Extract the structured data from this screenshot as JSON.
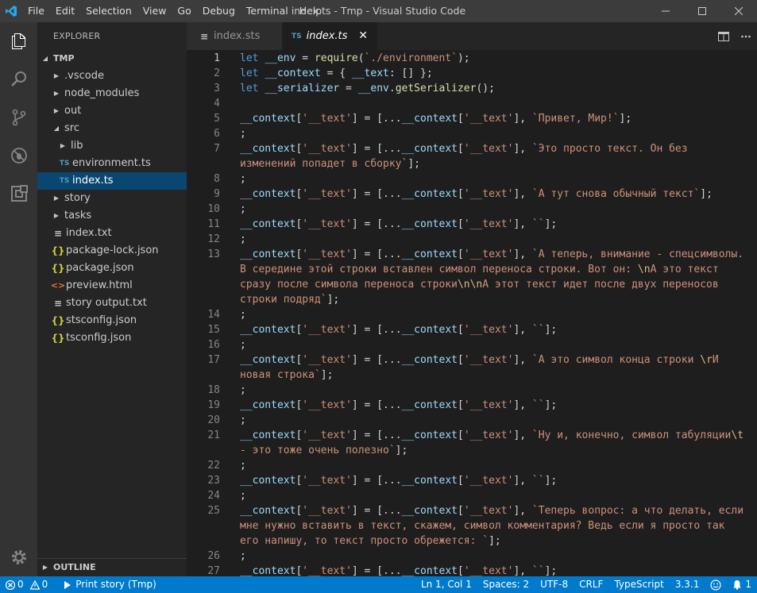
{
  "menu": [
    "File",
    "Edit",
    "Selection",
    "View",
    "Go",
    "Debug",
    "Terminal",
    "Help"
  ],
  "window_title": "index.ts - Tmp - Visual Studio Code",
  "sidebar": {
    "header": "EXPLORER",
    "root": "TMP",
    "items": [
      {
        "label": ".vscode",
        "kind": "folder",
        "level": 1,
        "open": false
      },
      {
        "label": "node_modules",
        "kind": "folder",
        "level": 1,
        "open": false
      },
      {
        "label": "out",
        "kind": "folder",
        "level": 1,
        "open": false
      },
      {
        "label": "src",
        "kind": "folder",
        "level": 1,
        "open": true
      },
      {
        "label": "lib",
        "kind": "folder",
        "level": 2,
        "open": false
      },
      {
        "label": "environment.ts",
        "kind": "ts",
        "level": 2
      },
      {
        "label": "index.ts",
        "kind": "ts",
        "level": 2,
        "selected": true
      },
      {
        "label": "story",
        "kind": "folder",
        "level": 1,
        "open": false
      },
      {
        "label": "tasks",
        "kind": "folder",
        "level": 1,
        "open": false
      },
      {
        "label": "index.txt",
        "kind": "txt",
        "level": 1
      },
      {
        "label": "package-lock.json",
        "kind": "json",
        "level": 1
      },
      {
        "label": "package.json",
        "kind": "json",
        "level": 1
      },
      {
        "label": "preview.html",
        "kind": "html",
        "level": 1
      },
      {
        "label": "story output.txt",
        "kind": "txt",
        "level": 1
      },
      {
        "label": "stsconfig.json",
        "kind": "json",
        "level": 1
      },
      {
        "label": "tsconfig.json",
        "kind": "json",
        "level": 1
      }
    ],
    "outline": "OUTLINE"
  },
  "tabs": [
    {
      "label": "index.sts",
      "active": false
    },
    {
      "label": "index.ts",
      "badge": "TS",
      "active": true,
      "close": "✕"
    }
  ],
  "code_lines": [
    {
      "n": "1",
      "parts": [
        [
          "k",
          "let"
        ],
        [
          "p",
          " "
        ],
        [
          "v",
          "__env"
        ],
        [
          "p",
          " = "
        ],
        [
          "f",
          "require"
        ],
        [
          "p",
          "("
        ],
        [
          "s",
          "`./environment`"
        ],
        [
          "p",
          ");"
        ]
      ]
    },
    {
      "n": "2",
      "parts": [
        [
          "k",
          "let"
        ],
        [
          "p",
          " "
        ],
        [
          "v",
          "__context"
        ],
        [
          "p",
          " = { "
        ],
        [
          "v",
          "__text"
        ],
        [
          "p",
          ": [] };"
        ]
      ]
    },
    {
      "n": "3",
      "parts": [
        [
          "k",
          "let"
        ],
        [
          "p",
          " "
        ],
        [
          "v",
          "__serializer"
        ],
        [
          "p",
          " = "
        ],
        [
          "v",
          "__env"
        ],
        [
          "p",
          "."
        ],
        [
          "f",
          "getSerializer"
        ],
        [
          "p",
          "();"
        ]
      ]
    },
    {
      "n": "4",
      "parts": []
    },
    {
      "n": "5",
      "parts": [
        [
          "v",
          "__context"
        ],
        [
          "p",
          "["
        ],
        [
          "s",
          "'__text'"
        ],
        [
          "p",
          "] = [..."
        ],
        [
          "v",
          "__context"
        ],
        [
          "p",
          "["
        ],
        [
          "s",
          "'__text'"
        ],
        [
          "p",
          "], "
        ],
        [
          "s",
          "`Привет, Мир!`"
        ],
        [
          "p",
          "];"
        ]
      ]
    },
    {
      "n": "6",
      "parts": [
        [
          "p",
          ";"
        ]
      ]
    },
    {
      "n": "7",
      "parts": [
        [
          "v",
          "__context"
        ],
        [
          "p",
          "["
        ],
        [
          "s",
          "'__text'"
        ],
        [
          "p",
          "] = [..."
        ],
        [
          "v",
          "__context"
        ],
        [
          "p",
          "["
        ],
        [
          "s",
          "'__text'"
        ],
        [
          "p",
          "], "
        ],
        [
          "s",
          "`Это просто текст. Он без"
        ]
      ]
    },
    {
      "n": "",
      "parts": [
        [
          "s",
          "изменений попадет в сборку`"
        ],
        [
          "p",
          "];"
        ]
      ]
    },
    {
      "n": "8",
      "parts": [
        [
          "p",
          ";"
        ]
      ]
    },
    {
      "n": "9",
      "parts": [
        [
          "v",
          "__context"
        ],
        [
          "p",
          "["
        ],
        [
          "s",
          "'__text'"
        ],
        [
          "p",
          "] = [..."
        ],
        [
          "v",
          "__context"
        ],
        [
          "p",
          "["
        ],
        [
          "s",
          "'__text'"
        ],
        [
          "p",
          "], "
        ],
        [
          "s",
          "`А тут снова обычный текст`"
        ],
        [
          "p",
          "];"
        ]
      ]
    },
    {
      "n": "10",
      "parts": [
        [
          "p",
          ";"
        ]
      ]
    },
    {
      "n": "11",
      "parts": [
        [
          "v",
          "__context"
        ],
        [
          "p",
          "["
        ],
        [
          "s",
          "'__text'"
        ],
        [
          "p",
          "] = [..."
        ],
        [
          "v",
          "__context"
        ],
        [
          "p",
          "["
        ],
        [
          "s",
          "'__text'"
        ],
        [
          "p",
          "], "
        ],
        [
          "s",
          "``"
        ],
        [
          "p",
          "];"
        ]
      ]
    },
    {
      "n": "12",
      "parts": [
        [
          "p",
          ";"
        ]
      ]
    },
    {
      "n": "13",
      "parts": [
        [
          "v",
          "__context"
        ],
        [
          "p",
          "["
        ],
        [
          "s",
          "'__text'"
        ],
        [
          "p",
          "] = [..."
        ],
        [
          "v",
          "__context"
        ],
        [
          "p",
          "["
        ],
        [
          "s",
          "'__text'"
        ],
        [
          "p",
          "], "
        ],
        [
          "s",
          "`А теперь, внимание - спецсимволы."
        ]
      ]
    },
    {
      "n": "",
      "parts": [
        [
          "s",
          "В середине этой строки вставлен символ переноса строки. Вот он: "
        ],
        [
          "e",
          "\\n"
        ],
        [
          "s",
          "А это текст"
        ]
      ]
    },
    {
      "n": "",
      "parts": [
        [
          "s",
          "сразу после символа переноса строки"
        ],
        [
          "e",
          "\\n\\n"
        ],
        [
          "s",
          "А этот текст идет после двух переносов"
        ]
      ]
    },
    {
      "n": "",
      "parts": [
        [
          "s",
          "строки подряд`"
        ],
        [
          "p",
          "];"
        ]
      ]
    },
    {
      "n": "14",
      "parts": [
        [
          "p",
          ";"
        ]
      ]
    },
    {
      "n": "15",
      "parts": [
        [
          "v",
          "__context"
        ],
        [
          "p",
          "["
        ],
        [
          "s",
          "'__text'"
        ],
        [
          "p",
          "] = [..."
        ],
        [
          "v",
          "__context"
        ],
        [
          "p",
          "["
        ],
        [
          "s",
          "'__text'"
        ],
        [
          "p",
          "], "
        ],
        [
          "s",
          "``"
        ],
        [
          "p",
          "];"
        ]
      ]
    },
    {
      "n": "16",
      "parts": [
        [
          "p",
          ";"
        ]
      ]
    },
    {
      "n": "17",
      "parts": [
        [
          "v",
          "__context"
        ],
        [
          "p",
          "["
        ],
        [
          "s",
          "'__text'"
        ],
        [
          "p",
          "] = [..."
        ],
        [
          "v",
          "__context"
        ],
        [
          "p",
          "["
        ],
        [
          "s",
          "'__text'"
        ],
        [
          "p",
          "], "
        ],
        [
          "s",
          "`А это символ конца строки "
        ],
        [
          "e",
          "\\r"
        ],
        [
          "s",
          "И"
        ]
      ]
    },
    {
      "n": "",
      "parts": [
        [
          "s",
          "новая строка`"
        ],
        [
          "p",
          "];"
        ]
      ]
    },
    {
      "n": "18",
      "parts": [
        [
          "p",
          ";"
        ]
      ]
    },
    {
      "n": "19",
      "parts": [
        [
          "v",
          "__context"
        ],
        [
          "p",
          "["
        ],
        [
          "s",
          "'__text'"
        ],
        [
          "p",
          "] = [..."
        ],
        [
          "v",
          "__context"
        ],
        [
          "p",
          "["
        ],
        [
          "s",
          "'__text'"
        ],
        [
          "p",
          "], "
        ],
        [
          "s",
          "``"
        ],
        [
          "p",
          "];"
        ]
      ]
    },
    {
      "n": "20",
      "parts": [
        [
          "p",
          ";"
        ]
      ]
    },
    {
      "n": "21",
      "parts": [
        [
          "v",
          "__context"
        ],
        [
          "p",
          "["
        ],
        [
          "s",
          "'__text'"
        ],
        [
          "p",
          "] = [..."
        ],
        [
          "v",
          "__context"
        ],
        [
          "p",
          "["
        ],
        [
          "s",
          "'__text'"
        ],
        [
          "p",
          "], "
        ],
        [
          "s",
          "`Ну и, конечно, символ табуляции"
        ],
        [
          "e",
          "\\t"
        ]
      ]
    },
    {
      "n": "",
      "parts": [
        [
          "s",
          "- это тоже очень полезно`"
        ],
        [
          "p",
          "];"
        ]
      ]
    },
    {
      "n": "22",
      "parts": [
        [
          "p",
          ";"
        ]
      ]
    },
    {
      "n": "23",
      "parts": [
        [
          "v",
          "__context"
        ],
        [
          "p",
          "["
        ],
        [
          "s",
          "'__text'"
        ],
        [
          "p",
          "] = [..."
        ],
        [
          "v",
          "__context"
        ],
        [
          "p",
          "["
        ],
        [
          "s",
          "'__text'"
        ],
        [
          "p",
          "], "
        ],
        [
          "s",
          "``"
        ],
        [
          "p",
          "];"
        ]
      ]
    },
    {
      "n": "24",
      "parts": [
        [
          "p",
          ";"
        ]
      ]
    },
    {
      "n": "25",
      "parts": [
        [
          "v",
          "__context"
        ],
        [
          "p",
          "["
        ],
        [
          "s",
          "'__text'"
        ],
        [
          "p",
          "] = [..."
        ],
        [
          "v",
          "__context"
        ],
        [
          "p",
          "["
        ],
        [
          "s",
          "'__text'"
        ],
        [
          "p",
          "], "
        ],
        [
          "s",
          "`Теперь вопрос: а что делать, если"
        ]
      ]
    },
    {
      "n": "",
      "parts": [
        [
          "s",
          "мне нужно вставить в текст, скажем, символ комментария? Ведь если я просто так"
        ]
      ]
    },
    {
      "n": "",
      "parts": [
        [
          "s",
          "его напишу, то текст просто обрежется: `"
        ],
        [
          "p",
          "];"
        ]
      ]
    },
    {
      "n": "26",
      "parts": [
        [
          "p",
          ";"
        ]
      ]
    },
    {
      "n": "27",
      "parts": [
        [
          "v",
          "__context"
        ],
        [
          "p",
          "["
        ],
        [
          "s",
          "'__text'"
        ],
        [
          "p",
          "] = [..."
        ],
        [
          "v",
          "__context"
        ],
        [
          "p",
          "["
        ],
        [
          "s",
          "'__text'"
        ],
        [
          "p",
          "], "
        ],
        [
          "s",
          "``"
        ],
        [
          "p",
          "];"
        ]
      ]
    }
  ],
  "status": {
    "errors": "0",
    "warnings": "0",
    "run": "Print story (Tmp)",
    "position": "Ln 1, Col 1",
    "spaces": "Spaces: 2",
    "encoding": "UTF-8",
    "eol": "CRLF",
    "language": "TypeScript",
    "version": "3.3.1",
    "notifications": "1"
  },
  "colors": {
    "accent": "#007acc",
    "keyword": "#569cd6",
    "variable": "#9cdcfe",
    "function": "#dcdcaa",
    "string": "#ce9178",
    "escape": "#d7ba7d"
  },
  "icons": [
    "vscode-logo-icon",
    "files-icon",
    "search-icon",
    "source-control-icon",
    "debug-icon",
    "extensions-icon",
    "gear-icon",
    "split-editor-icon",
    "more-actions-icon",
    "minimize-icon",
    "maximize-icon",
    "close-icon",
    "error-icon",
    "warning-icon",
    "play-icon",
    "smiley-icon",
    "bell-icon"
  ]
}
